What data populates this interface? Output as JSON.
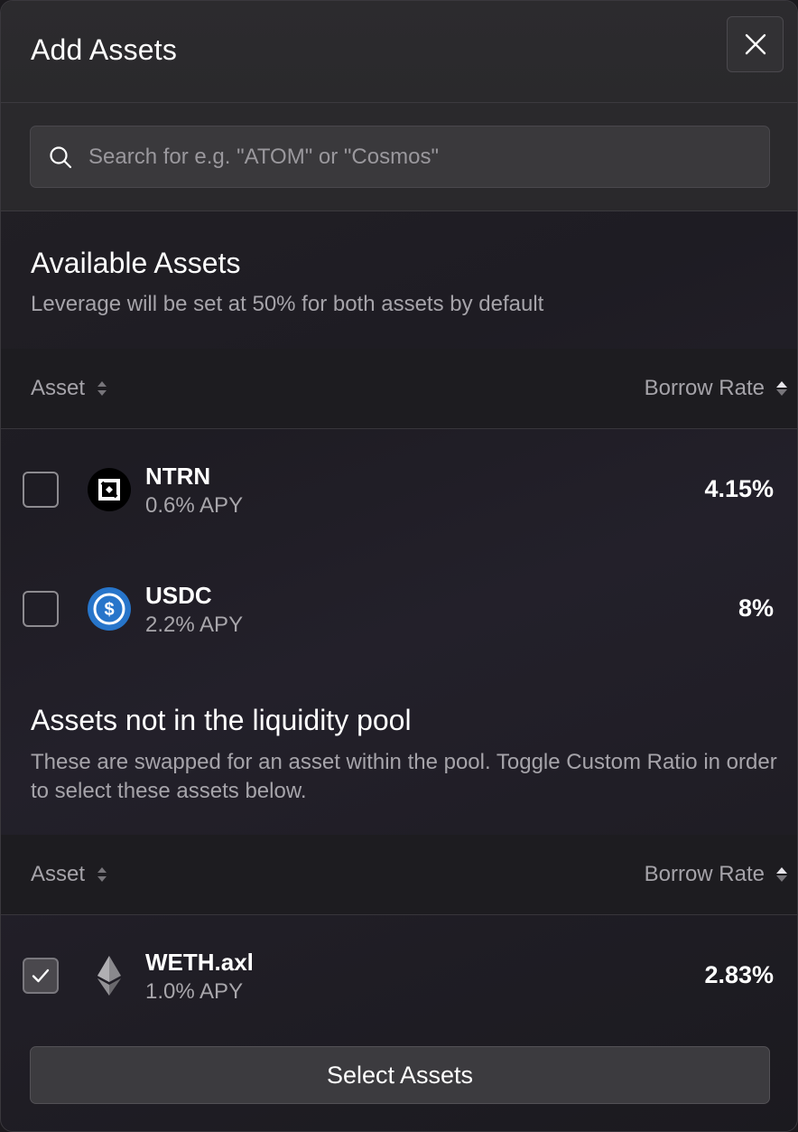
{
  "modal": {
    "title": "Add Assets",
    "close_icon": "close-icon"
  },
  "search": {
    "placeholder": "Search for e.g. \"ATOM\" or \"Cosmos\"",
    "value": "",
    "icon": "search-icon"
  },
  "available": {
    "title": "Available Assets",
    "subtitle": "Leverage will be set at 50% for both assets by default",
    "columns": {
      "asset": "Asset",
      "borrow_rate": "Borrow Rate"
    },
    "rows": [
      {
        "symbol": "NTRN",
        "apy": "0.6% APY",
        "borrow_rate": "4.15%",
        "checked": false,
        "icon": "ntrn-icon"
      },
      {
        "symbol": "USDC",
        "apy": "2.2% APY",
        "borrow_rate": "8%",
        "checked": false,
        "icon": "usdc-icon"
      }
    ]
  },
  "not_in_pool": {
    "title": "Assets not in the liquidity pool",
    "subtitle": "These are swapped for an asset within the pool. Toggle Custom Ratio in order to select these assets below.",
    "columns": {
      "asset": "Asset",
      "borrow_rate": "Borrow Rate"
    },
    "rows": [
      {
        "symbol": "WETH.axl",
        "apy": "1.0% APY",
        "borrow_rate": "2.83%",
        "checked": true,
        "icon": "eth-icon"
      }
    ]
  },
  "actions": {
    "select_label": "Select Assets"
  },
  "colors": {
    "background": "#1c1a1e",
    "header": "#2a292c",
    "usdc_blue": "#2775ca"
  }
}
